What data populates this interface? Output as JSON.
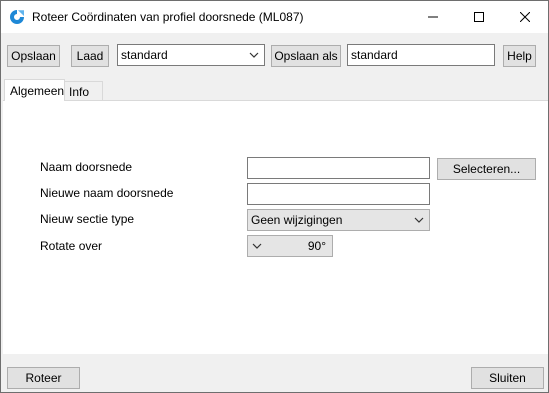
{
  "window": {
    "title": "Roteer Coördinaten van profiel doorsnede (ML087)",
    "icons": {
      "app": "app-logo-icon",
      "minimize": "minimize-icon",
      "maximize": "maximize-icon",
      "close": "close-icon"
    }
  },
  "toolbar": {
    "save_label": "Opslaan",
    "load_label": "Laad",
    "preset_value": "standard",
    "save_as_label": "Opslaan als",
    "save_as_value": "standard",
    "help_label": "Help"
  },
  "tabs": [
    {
      "label": "Algemeen",
      "active": true
    },
    {
      "label": "Info",
      "active": false
    }
  ],
  "form": {
    "section_name_label": "Naam doorsnede",
    "section_name_value": "",
    "select_label": "Selecteren...",
    "new_name_label": "Nieuwe naam doorsnede",
    "new_name_value": "",
    "section_type_label": "Nieuw sectie type",
    "section_type_value": "Geen wijzigingen",
    "rotate_label": "Rotate over",
    "rotate_value": "90°"
  },
  "footer": {
    "rotate_button": "Roteer",
    "close_button": "Sluiten"
  },
  "colors": {
    "app_icon": "#1e88d6",
    "button_face": "#e1e1e1",
    "window_bg": "#f0f0f0"
  }
}
